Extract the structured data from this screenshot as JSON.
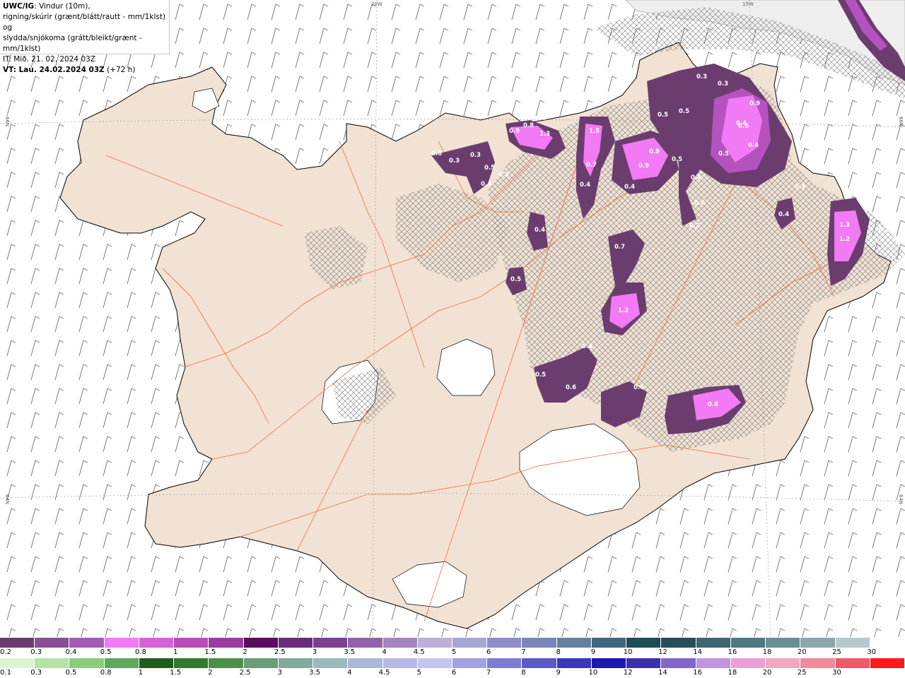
{
  "header": {
    "title_bold": "UWC/IG",
    "line1_rest": ": Vindur (10m),",
    "line2": "rigning/skúrir (grænt/blátt/rautt - mm/1klst) og",
    "line3": "slydda/snjókoma (grátt/bleikt/grænt - mm/1klst)",
    "line4": "IT: Mið. 21. 02. 2024 03Z",
    "line5_bold": "VT: Lau. 24.02.2024 03Z",
    "line5_rest": " (+72 h)"
  },
  "grid_labels": {
    "lon_20w": "20W",
    "lon_15w": "15W",
    "lat_66n_left": "66N",
    "lat_66n_right": "66N",
    "lat_64n_left": "64N",
    "lat_64n_right": "64N"
  },
  "precip_labels": [
    "0.3",
    "0.3",
    "0.5",
    "0.5",
    "1.3",
    "0.8",
    "0.9",
    "0.6",
    "1.5",
    "0.9",
    "0.5",
    "0.7",
    "0.9",
    "0.5",
    "0.4",
    "0.4",
    "0.5",
    "0.3",
    "0.4",
    "0.4",
    "0.4",
    "0.3",
    "0.3",
    "0.6",
    "1.3",
    "1.2",
    "0.2",
    "0.4",
    "0.7",
    "0.5",
    "0.2",
    "1.2",
    "0.4",
    "0.5",
    "0.6",
    "0.6",
    "0.8",
    "0.9",
    "0.4",
    "0.4",
    "0.5",
    "0.4"
  ],
  "colors": {
    "land": "#f1e2d4",
    "coast": "#000000",
    "roads": "#e8703a",
    "ice": "#ffffff",
    "sea": "#ffffff",
    "precip_light": "#6b3d6e",
    "precip_mid": "#b552c0",
    "precip_high": "#f27af5"
  },
  "scale_precip": {
    "ticks": [
      "0.2",
      "0.3",
      "0.4",
      "0.5",
      "0.8",
      "1",
      "1.5",
      "2",
      "2.5",
      "3",
      "3.5",
      "4",
      "4.5",
      "5",
      "6",
      "7",
      "8",
      "9",
      "10",
      "12",
      "14",
      "16",
      "18",
      "20",
      "25",
      "30"
    ],
    "colors": [
      "#6b3d6e",
      "#8a4d96",
      "#a25bb4",
      "#f27af5",
      "#d562d8",
      "#b84db8",
      "#9b3c9e",
      "#5a0d5e",
      "#6a2c7a",
      "#7d4190",
      "#9262a8",
      "#a585c0",
      "#bdb0d6",
      "#a7a6d4",
      "#8d8dc8",
      "#7a86b9",
      "#64829f",
      "#3d6880",
      "#1d4d55",
      "#284d5a",
      "#3c6670",
      "#4d7a82",
      "#6a8e95",
      "#8ba7ad",
      "#b6c9cc",
      "#ffffff"
    ]
  },
  "scale_rain": {
    "ticks": [
      "0.1",
      "0.3",
      "0.5",
      "0.8",
      "1",
      "1.5",
      "2",
      "2.5",
      "3",
      "3.5",
      "4",
      "4.5",
      "5",
      "6",
      "7",
      "8",
      "9",
      "10",
      "12",
      "14",
      "16",
      "18",
      "20",
      "25",
      "30"
    ],
    "colors": [
      "#dcf5d2",
      "#b5e3a3",
      "#8dcc7a",
      "#5ea85a",
      "#1d5e1d",
      "#2e7a2e",
      "#4b8f4b",
      "#6a9e76",
      "#83aaa0",
      "#9bb8bc",
      "#a9b8d4",
      "#b7b8e6",
      "#c5c5f0",
      "#a1a1e4",
      "#7d7dd8",
      "#5a5acb",
      "#3838be",
      "#1a1aae",
      "#3a2fb0",
      "#8066cc",
      "#c493e0",
      "#ec9ed8",
      "#f1a8c1",
      "#f08a9c",
      "#ec5a67",
      "#ff1a1a"
    ]
  }
}
